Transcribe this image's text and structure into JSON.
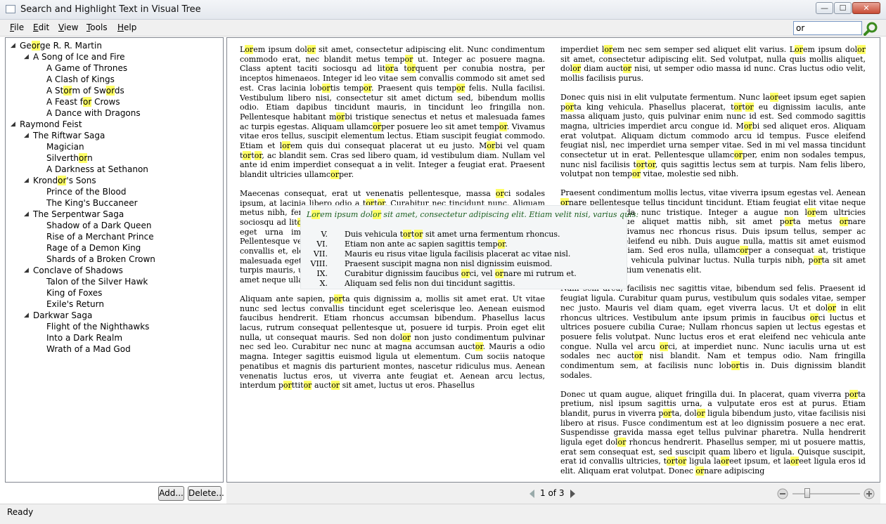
{
  "window": {
    "title": "Search and Highlight Text in Visual Tree",
    "min": "—",
    "max": "☐",
    "close": "✕"
  },
  "menu": [
    "File",
    "Edit",
    "View",
    "Tools",
    "Help"
  ],
  "search": {
    "value": "or"
  },
  "tree": [
    {
      "t": "George R. R. Martin",
      "lvl": 0,
      "exp": true
    },
    {
      "t": "A Song of Ice and Fire",
      "lvl": 1,
      "exp": true
    },
    {
      "t": "A Game of Thrones",
      "lvl": 2
    },
    {
      "t": "A Clash of Kings",
      "lvl": 2
    },
    {
      "t": "A Storm of Swords",
      "lvl": 2
    },
    {
      "t": "A Feast for Crows",
      "lvl": 2
    },
    {
      "t": "A Dance with Dragons",
      "lvl": 2
    },
    {
      "t": "Raymond Feist",
      "lvl": 0,
      "exp": true
    },
    {
      "t": "The Riftwar Saga",
      "lvl": 1,
      "exp": true
    },
    {
      "t": "Magician",
      "lvl": 2
    },
    {
      "t": "Silverthorn",
      "lvl": 2
    },
    {
      "t": "A Darkness at Sethanon",
      "lvl": 2
    },
    {
      "t": "Krondor's Sons",
      "lvl": 1,
      "exp": true
    },
    {
      "t": "Prince of the Blood",
      "lvl": 2
    },
    {
      "t": "The King's Buccaneer",
      "lvl": 2
    },
    {
      "t": "The Serpentwar Saga",
      "lvl": 1,
      "exp": true
    },
    {
      "t": "Shadow of a Dark Queen",
      "lvl": 2
    },
    {
      "t": "Rise of a Merchant Prince",
      "lvl": 2
    },
    {
      "t": "Rage of a Demon King",
      "lvl": 2
    },
    {
      "t": "Shards of a Broken Crown",
      "lvl": 2
    },
    {
      "t": "Conclave of Shadows",
      "lvl": 1,
      "exp": true
    },
    {
      "t": "Talon of the Silver Hawk",
      "lvl": 2
    },
    {
      "t": "King of Foxes",
      "lvl": 2
    },
    {
      "t": "Exile's Return",
      "lvl": 2
    },
    {
      "t": "Darkwar Saga",
      "lvl": 1,
      "exp": true
    },
    {
      "t": "Flight of the Nighthawks",
      "lvl": 2
    },
    {
      "t": "Into a Dark Realm",
      "lvl": 2
    },
    {
      "t": "Wrath of a Mad God",
      "lvl": 2
    }
  ],
  "buttons": {
    "add": "Add...",
    "delete": "Delete..."
  },
  "doc": {
    "left": [
      "Lorem ipsum dolor sit amet, consectetur adipiscing elit. Nunc condimentum commodo erat, nec blandit metus tempor ut. Integer ac posuere magna. Class aptent taciti sociosqu ad litora torquent per conubia nostra, per inceptos himenaeos. Integer id leo vitae sem convallis commodo sit amet sed est. Cras lacinia lobortis tempor. Praesent quis tempor felis. Nulla facilisi. Vestibulum libero nisi, consectetur sit amet dictum sed, bibendum mollis odio. Etiam dapibus tincidunt mauris, in tincidunt leo fringilla non. Pellentesque habitant morbi tristique senectus et netus et malesuada fames ac turpis egestas. Aliquam ullamcorper posuere leo sit amet tempor. Vivamus vitae eros tellus, suscipit elementum lectus. Etiam suscipit feugiat commodo. Etiam et lorem quis dui consequat placerat ut eu justo. Morbi vel quam tortor, ac blandit sem. Cras sed libero quam, id vestibulum diam. Nullam vel ante id enim imperdiet consequat a in velit. Integer a feugiat erat. Praesent blandit ultricies ullamcorper.",
      "Maecenas consequat, erat ut venenatis pellentesque, massa orci sodales ipsum, at lacinia libero odio a tortor. Curabitur nec tincidunt nunc. Aliquam metus nibh, fermentum ac cursus ut, ultrices nec nunc. Class aptent taciti sociosqu ad litora torquent per conubia nostra, per inceptos himenaeos. Sed eget urna imperdiet neque accumsan molestie sit amet at augue. Pellentesque vestibulum ullamcorper lacus. Donec dui massa, volutpat vitae convallis et, eleifend eget neque. Cras odio mauris, lacinia quis iaculis ac, malesuada eget ante. Vivamus eu lorem diam, eu posuere diam. Suspendisse turpis mauris, ultrices a commodo in, sodales vitae felis. Donec vel libero sit amet neque ullamcorper porttitor et quis mauris.",
      "Aliquam ante sapien, porta quis dignissim a, mollis sit amet erat. Ut vitae nunc sed lectus convallis tincidunt eget scelerisque leo. Aenean euismod faucibus hendrerit. Etiam rhoncus accumsan bibendum. Phasellus lacus lacus, rutrum consequat pellentesque ut, posuere id turpis. Proin eget elit nulla, ut consequat mauris. Sed non dolor non justo condimentum pulvinar nec sed leo. Curabitur nec nunc at magna accumsan auctor. Mauris a odio magna. Integer sagittis euismod ligula ut elementum. Cum sociis natoque penatibus et magnis dis parturient montes, nascetur ridiculus mus. Aenean venenatis luctus eros, ut viverra ante feugiat et. Aenean arcu lectus, interdum porttitor auctor sit amet, luctus ut eros. Phasellus"
    ],
    "right": [
      "imperdiet lorem nec sem semper sed aliquet elit varius. Lorem ipsum dolor sit amet, consectetur adipiscing elit. Sed volutpat, nulla quis mollis aliquet, dolor diam auctor nisi, ut semper odio massa id nunc. Cras luctus odio velit, mollis facilisis purus.",
      "Donec quis nisi in elit vulputate fermentum. Nunc laoreet ipsum eget sapien porta king vehicula. Phasellus placerat, tortor eu dignissim iaculis, ante massa aliquam justo, quis pulvinar enim nunc id est. Sed commodo sagittis magna, ultricies imperdiet arcu congue id. Morbi sed aliquet eros. Aliquam erat volutpat. Aliquam dictum commodo arcu id tempus. Fusce eleifend feugiat nisl, nec imperdiet urna semper vitae. Sed in mi vel massa tincidunt consectetur ut in erat. Pellentesque ullamcorper, enim non sodales tempus, nunc nisl facilisis tortor, quis sagittis lectus sem at turpis. Nam felis libero, volutpat non tempor vitae, molestie sed nibh.",
      "Praesent condimentum mollis lectus, vitae viverra ipsum egestas vel. Aenean ornare pellentesque tellus tincidunt tincidunt. Etiam feugiat elit vitae neque auctor at gravida nunc tristique. Integer a augue non lorem ultricies ultricies. Quisque aliquet mattis nibh, sit amet porta metus ornare condimentum. Vivamus nec rhoncus risus. Duis ipsum tellus, semper ac accumsan non, eleifend eu nibh. Duis augue nulla, mattis sit amet euismod quis, luctus at diam. Sed eros nulla, ullamcorper a consequat at, tristique non tortor. Nunc vehicula pulvinar luctus. Nulla turpis nibh, porta sit amet tincidunt eu, pretium venenatis elit.",
      "Nam sem arcu, facilisis nec sagittis vitae, bibendum sed felis. Praesent id feugiat ligula. Curabitur quam purus, vestibulum quis sodales vitae, semper nec justo. Mauris vel diam quam, eget viverra lacus. Ut et dolor in elit rhoncus ultrices. Vestibulum ante ipsum primis in faucibus orci luctus et ultrices posuere cubilia Curae; Nullam rhoncus sapien ut lectus egestas et posuere felis volutpat. Nunc luctus eros et erat eleifend nec vehicula ante congue. Nulla vel arcu orci, at imperdiet nunc. Nunc iaculis urna ut est sodales nec auctor nisi blandit. Nam et tempus odio. Nam fringilla condimentum sem, at facilisis nunc lobortis in. Duis dignissim blandit sodales.",
      "Donec ut quam augue, aliquet fringilla dui. In placerat, quam viverra porta pretium, nisl ipsum sagittis urna, a vulputate eros est at purus. Etiam blandit, purus in viverra porta, dolor ligula bibendum justo, vitae facilisis nisi libero at risus. Fusce condimentum est at leo dignissim posuere a nec erat. Suspendisse gravida massa eget tellus pulvinar pharetra. Nulla hendrerit ligula eget dolor rhoncus hendrerit. Phasellus semper, mi ut posuere mattis, erat sem consequat est, sed suscipit quam libero et ligula. Quisque suscipit, erat id convallis ultricies, tortor ligula laoreet ipsum, et laoreet ligula eros id elit. Aliquam erat volutpat. Donec ornare adipiscing"
    ],
    "callout": {
      "heading": "Lorem ipsum dolor sit amet, consectetur adipiscing elit. Etiam velit nisi, varius quis:",
      "items": [
        {
          "n": "V.",
          "t": "Duis vehicula tortor sit amet urna fermentum rhoncus."
        },
        {
          "n": "VI.",
          "t": "Etiam non ante ac sapien sagittis tempor."
        },
        {
          "n": "VII.",
          "t": "Mauris eu risus vitae ligula facilisis placerat ac vitae nisl."
        },
        {
          "n": "VIII.",
          "t": "Praesent suscipit magna non nisl dignissim euismod."
        },
        {
          "n": "IX.",
          "t": "Curabitur dignissim faucibus orci, vel ornare mi rutrum et."
        },
        {
          "n": "X.",
          "t": "Aliquam sed felis non dui tincidunt sagittis."
        }
      ]
    }
  },
  "pager": {
    "current": "1",
    "of": "of",
    "total": "3"
  },
  "status": "Ready"
}
